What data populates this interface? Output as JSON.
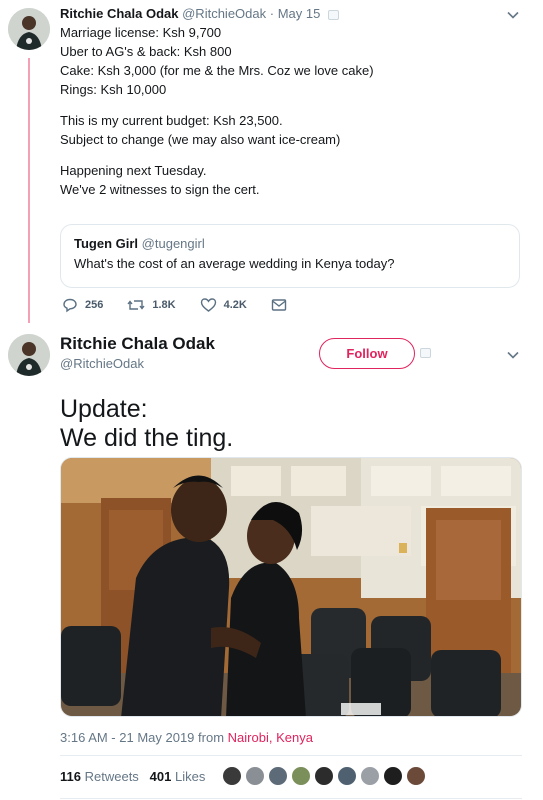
{
  "tweet1": {
    "name": "Ritchie Chala Odak",
    "handle": "@RitchieOdak",
    "separator": "·",
    "date": "May 15",
    "lines": [
      "Marriage license: Ksh 9,700",
      "Uber to AG's & back: Ksh 800",
      "Cake: Ksh 3,000 (for me & the Mrs. Coz we love cake)",
      "Rings: Ksh 10,000",
      "This is my current budget: Ksh 23,500.",
      "Subject to change (we may also want ice-cream)",
      "Happening next Tuesday.",
      "We've 2 witnesses to sign the cert."
    ],
    "quote": {
      "name": "Tugen Girl",
      "handle": "@tugengirl",
      "text": "What's the cost of an average wedding in Kenya today?"
    },
    "actions": {
      "replies": "256",
      "retweets": "1.8K",
      "likes": "4.2K"
    }
  },
  "tweet2": {
    "name": "Ritchie Chala Odak",
    "handle": "@RitchieOdak",
    "follow_label": "Follow",
    "text_line1": "Update:",
    "text_line2": "We did the ting.",
    "time": "3:16 AM - 21 May 2019",
    "from_word": "from",
    "location": "Nairobi, Kenya",
    "retweets_count": "116",
    "retweets_label": "Retweets",
    "likes_count": "401",
    "likes_label": "Likes"
  },
  "colors": {
    "accent": "#e0245e",
    "thread": "#f4a0b6",
    "muted": "#657786"
  }
}
